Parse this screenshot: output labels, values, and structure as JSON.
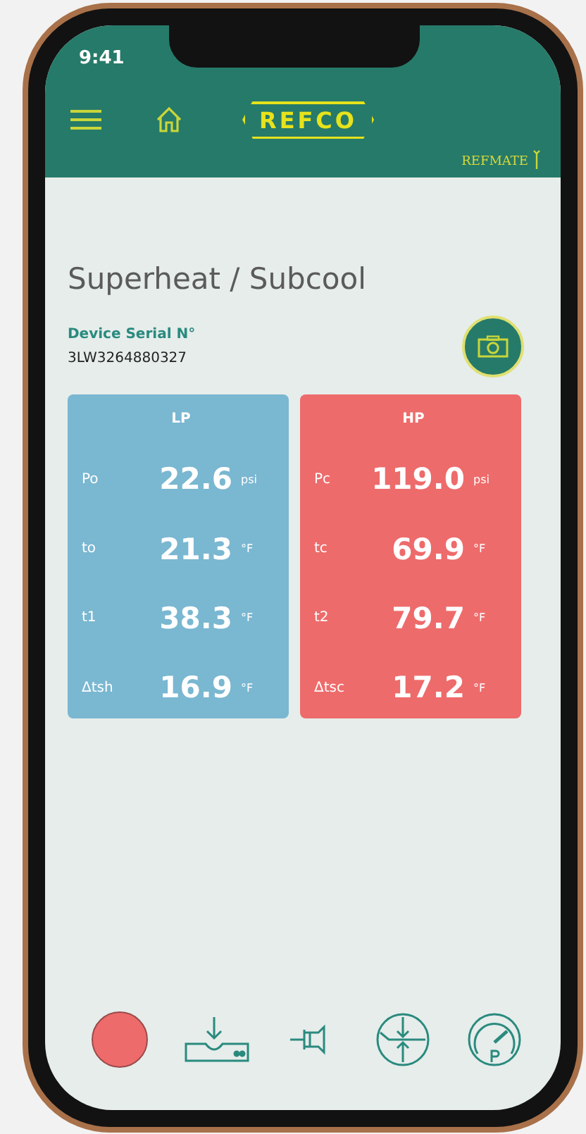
{
  "status_bar": {
    "time": "9:41"
  },
  "header": {
    "logo": "REFCO",
    "device": "REFMATE"
  },
  "title": "Superheat / Subcool",
  "device_serial": {
    "label": "Device Serial N°",
    "value": "3LW3264880327"
  },
  "panels": [
    {
      "title": "LP",
      "color": "#7ab7d1",
      "rows": [
        {
          "label": "Po",
          "value": "22.6",
          "unit": "psi"
        },
        {
          "label": "to",
          "value": "21.3",
          "unit": "°F"
        },
        {
          "label": "t1",
          "value": "38.3",
          "unit": "°F"
        },
        {
          "label": "Δtsh",
          "value": "16.9",
          "unit": "°F"
        }
      ]
    },
    {
      "title": "HP",
      "color": "#ee6b6b",
      "rows": [
        {
          "label": "Pc",
          "value": "119.0",
          "unit": "psi"
        },
        {
          "label": "tc",
          "value": "69.9",
          "unit": "°F"
        },
        {
          "label": "t2",
          "value": "79.7",
          "unit": "°F"
        },
        {
          "label": "Δtsc",
          "value": "17.2",
          "unit": "°F"
        }
      ]
    }
  ]
}
